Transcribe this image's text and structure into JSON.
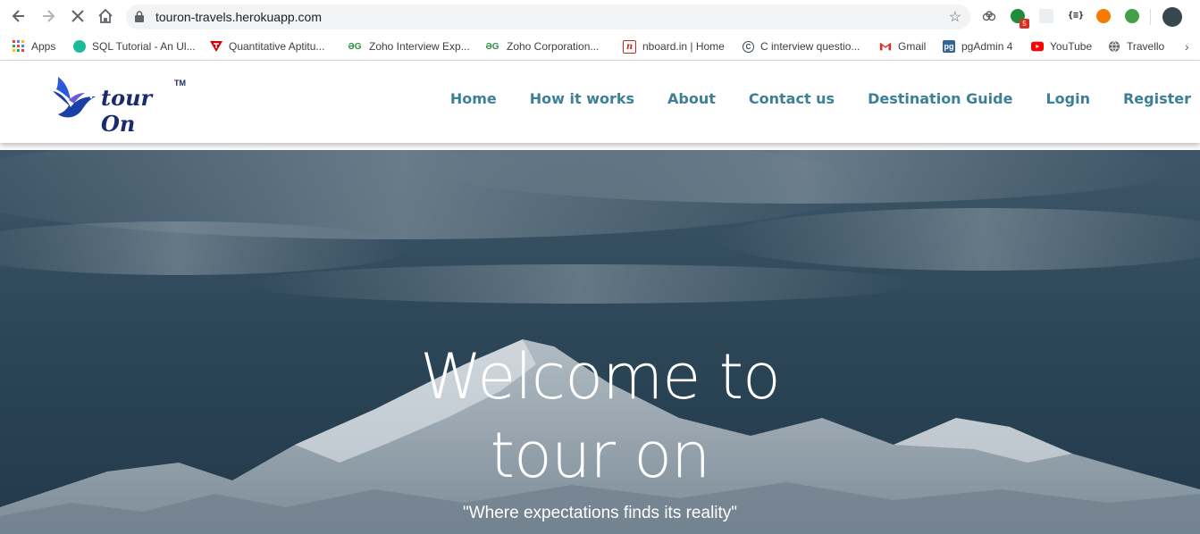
{
  "browser": {
    "url": "touron-travels.herokuapp.com",
    "extension_badge": "5",
    "bookmarks": [
      {
        "label": "Apps",
        "icon": "apps-grid-icon"
      },
      {
        "label": "SQL Tutorial - An Ul...",
        "icon": "sql-icon"
      },
      {
        "label": "Quantitative Aptitu...",
        "icon": "indiabix-icon"
      },
      {
        "label": "Zoho Interview Exp...",
        "icon": "geeksforgeeks-icon"
      },
      {
        "label": "Zoho Corporation...",
        "icon": "geeksforgeeks-icon"
      },
      {
        "label": "nboard.in | Home",
        "icon": "nboard-icon"
      },
      {
        "label": "C interview questio...",
        "icon": "c-icon"
      },
      {
        "label": "Gmail",
        "icon": "gmail-icon"
      },
      {
        "label": "pgAdmin 4",
        "icon": "pgadmin-icon"
      },
      {
        "label": "YouTube",
        "icon": "youtube-icon"
      },
      {
        "label": "Travello",
        "icon": "globe-icon"
      }
    ]
  },
  "site": {
    "logo_text": "tour On",
    "logo_tm": "TM",
    "nav": [
      "Home",
      "How it works",
      "About",
      "Contact us",
      "Destination Guide",
      "Login",
      "Register"
    ],
    "hero_line1": "Welcome to",
    "hero_line2": "tour on",
    "tagline": "\"Where expectations finds its reality\""
  },
  "colors": {
    "nav_link": "#3d7f97",
    "logo_blue": "#1a2a6c",
    "hero_sky": "#2f4a5c"
  }
}
